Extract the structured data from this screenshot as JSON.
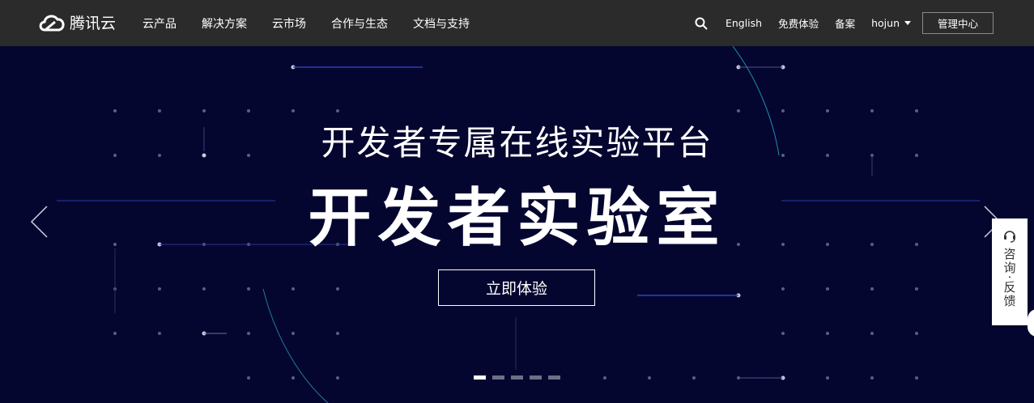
{
  "header": {
    "brand": "腾讯云",
    "nav": [
      "云产品",
      "解决方案",
      "云市场",
      "合作与生态",
      "文档与支持"
    ],
    "search_icon": "search-icon",
    "links": [
      "English",
      "免费体验",
      "备案"
    ],
    "user": "hojun",
    "console_button": "管理中心"
  },
  "hero": {
    "subtitle": "开发者专属在线实验平台",
    "title": "开发者实验室",
    "cta": "立即体验",
    "slides": 5,
    "active_slide": 1
  },
  "float_widget": {
    "icon": "headset-icon",
    "label": "咨询·反馈"
  },
  "colors": {
    "topbar": "#2b2b2b",
    "hero_background": "#050630",
    "text": "#ffffff"
  }
}
